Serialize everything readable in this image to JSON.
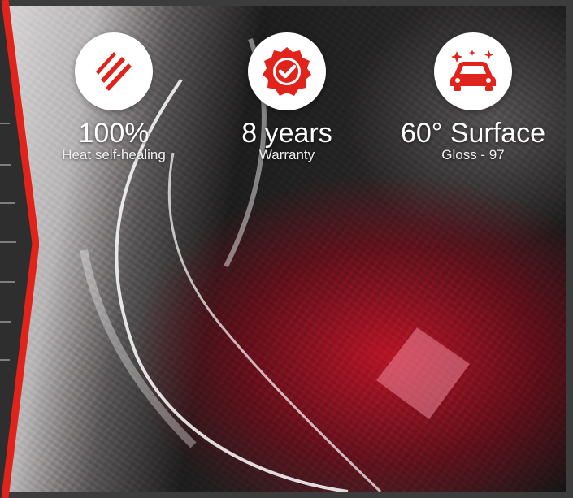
{
  "colors": {
    "accent": "#e0241c",
    "circle_bg": "#ffffff",
    "text": "#ffffff",
    "frame": "#3c3c3c"
  },
  "features": [
    {
      "icon": "claw-scratch-icon",
      "value": "100%",
      "caption": "Heat self-healing"
    },
    {
      "icon": "checkmark-badge-icon",
      "value": "8 years",
      "caption": "Warranty"
    },
    {
      "icon": "sparkling-car-icon",
      "value": "60° Surface",
      "caption": "Gloss - 97"
    }
  ]
}
